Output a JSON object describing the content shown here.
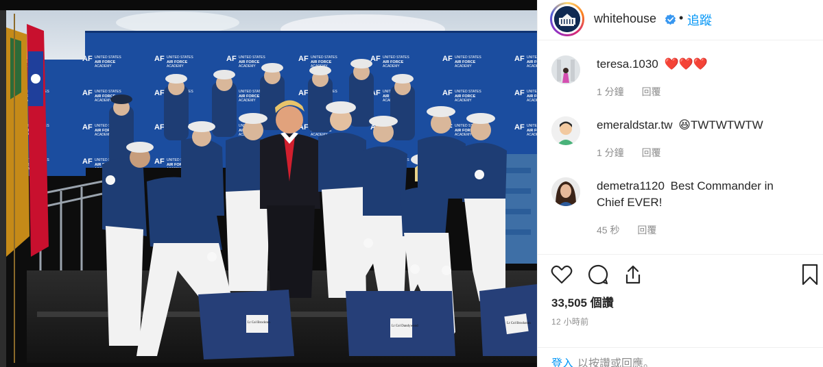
{
  "post": {
    "username": "whitehouse",
    "dot": "•",
    "follow_label": "追蹤"
  },
  "photo": {
    "backdrop_text_1": "AIR FORCE ACADEMY",
    "backdrop_text_2": "UNITED STATES",
    "backdrop_logo": "AF",
    "seat_card_1": "Lt Col Brockton",
    "seat_card_2": "Lt Col Dandywood",
    "seat_card_3": "Lt Col Brockston"
  },
  "comments": [
    {
      "user": "teresa.1030",
      "text": "❤️❤️❤️",
      "time": "1 分鐘",
      "reply": "回覆"
    },
    {
      "user": "emeraldstar.tw",
      "text": "😆TWTWTWTW",
      "time": "1 分鐘",
      "reply": "回覆"
    },
    {
      "user": "demetra1120",
      "text": "Best Commander in Chief EVER!",
      "time": "45 秒",
      "reply": "回覆"
    }
  ],
  "actions": {
    "icons": [
      "heart-icon",
      "comment-icon",
      "share-icon",
      "bookmark-icon"
    ],
    "likes": "33,505 個讚",
    "time_ago": "12 小時前"
  },
  "login": {
    "link": "登入",
    "text": "以按讚或回應。"
  },
  "colors": {
    "accent": "#0095f6",
    "text": "#262626",
    "muted": "#8e8e8e",
    "backdrop_blue": "#1a4a9c",
    "uniform_blue": "#1e3d74",
    "heart": "#ed4956"
  }
}
